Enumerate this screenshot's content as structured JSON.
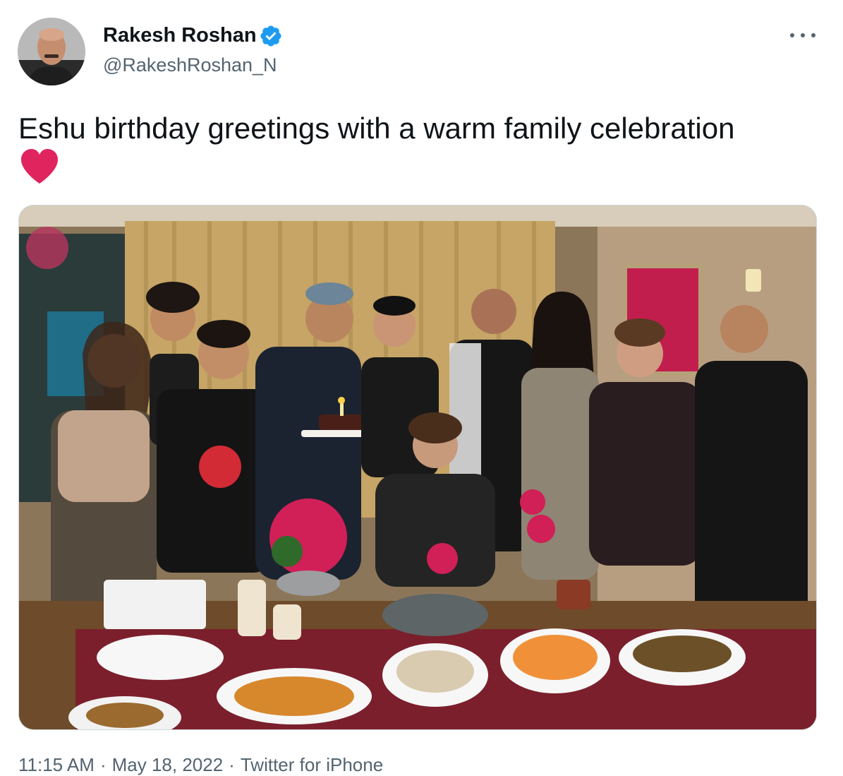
{
  "author": {
    "display_name": "Rakesh Roshan",
    "handle": "@RakeshRoshan_N",
    "verified_icon": "verified-badge-icon"
  },
  "tweet": {
    "text": "Eshu birthday greetings with a warm family celebration",
    "emoji": "heart-emoji"
  },
  "meta": {
    "time": "11:15 AM",
    "date": "May 18, 2022",
    "source": "Twitter for iPhone",
    "separator": "·"
  },
  "icons": {
    "more": "more-options-icon"
  },
  "colors": {
    "accent": "#1d9bf0",
    "heart": "#e0245e",
    "secondary_text": "#536471"
  }
}
